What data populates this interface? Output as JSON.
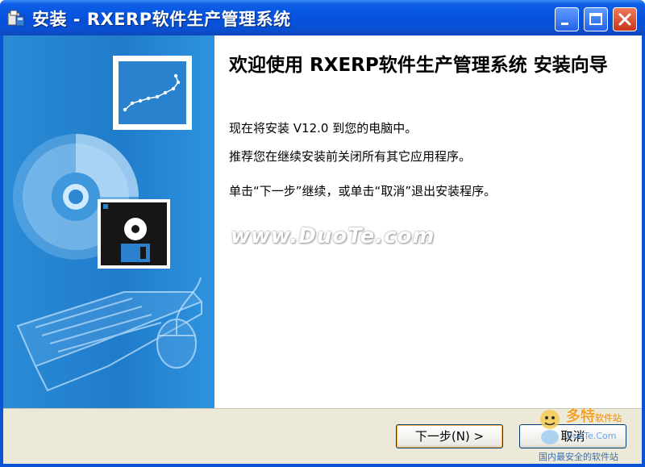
{
  "window": {
    "title": "安装 - RXERP软件生产管理系统",
    "controls": [
      "minimize",
      "maximize",
      "close"
    ]
  },
  "content": {
    "heading": "欢迎使用 RXERP软件生产管理系统 安装向导",
    "line1": "现在将安装 V12.0 到您的电脑中。",
    "line2": "推荐您在继续安装前关闭所有其它应用程序。",
    "line3": "单击“下一步”继续，或单击“取消”退出安装程序。",
    "watermark": "www.DuoTe.com"
  },
  "buttons": {
    "next": "下一步(N) >",
    "cancel": "取消"
  },
  "logo": {
    "brand": "多特",
    "brand_sub": "软件站",
    "url": "DuoTe.Com",
    "tagline": "国内最安全的软件站"
  },
  "icons": {
    "app": "setup-icon",
    "sidebar": [
      "chart-icon",
      "cd-icon",
      "floppy-disk-icon",
      "keyboard-icon",
      "mouse-icon"
    ]
  },
  "colors": {
    "titlebar": "#0552de",
    "sidebar": "#2385d2",
    "dialog_bg": "#ece9d8",
    "close_button": "#d8502e"
  }
}
